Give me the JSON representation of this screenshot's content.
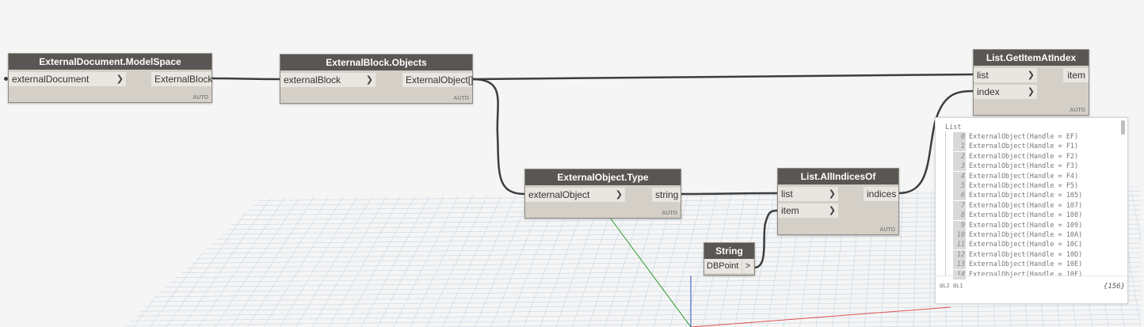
{
  "nodes": {
    "model_space": {
      "title": "ExternalDocument.ModelSpace",
      "input": "externalDocument",
      "output": "ExternalBlock",
      "lacing": "AUTO"
    },
    "block_objects": {
      "title": "ExternalBlock.Objects",
      "input": "externalBlock",
      "output": "ExternalObject[]",
      "lacing": "AUTO"
    },
    "object_type": {
      "title": "ExternalObject.Type",
      "input": "externalObject",
      "output": "string",
      "lacing": "AUTO"
    },
    "all_indices": {
      "title": "List.AllIndicesOf",
      "input_list": "list",
      "input_item": "item",
      "output": "indices",
      "lacing": "AUTO"
    },
    "get_item": {
      "title": "List.GetItemAtIndex",
      "input_list": "list",
      "input_index": "index",
      "output": "item",
      "lacing": "AUTO"
    },
    "string_node": {
      "title": "String",
      "value": "DBPoint",
      "output": ">"
    }
  },
  "preview": {
    "header": "List",
    "items": [
      {
        "index": "0",
        "text": "ExternalObject(Handle = EF)"
      },
      {
        "index": "1",
        "text": "ExternalObject(Handle = F1)"
      },
      {
        "index": "2",
        "text": "ExternalObject(Handle = F2)"
      },
      {
        "index": "3",
        "text": "ExternalObject(Handle = F3)"
      },
      {
        "index": "4",
        "text": "ExternalObject(Handle = F4)"
      },
      {
        "index": "5",
        "text": "ExternalObject(Handle = F5)"
      },
      {
        "index": "6",
        "text": "ExternalObject(Handle = 105)"
      },
      {
        "index": "7",
        "text": "ExternalObject(Handle = 107)"
      },
      {
        "index": "8",
        "text": "ExternalObject(Handle = 108)"
      },
      {
        "index": "9",
        "text": "ExternalObject(Handle = 109)"
      },
      {
        "index": "10",
        "text": "ExternalObject(Handle = 10A)"
      },
      {
        "index": "11",
        "text": "ExternalObject(Handle = 10C)"
      },
      {
        "index": "12",
        "text": "ExternalObject(Handle = 10D)"
      },
      {
        "index": "13",
        "text": "ExternalObject(Handle = 10E)"
      },
      {
        "index": "14",
        "text": "ExternalObject(Handle = 10F)"
      }
    ],
    "levels": "@L2 @L1",
    "count": "{156}"
  },
  "colors": {
    "node_header": "#5a5654",
    "node_body": "#d4d0c8",
    "wire": "#3d3d3d",
    "grid": "#c7d6e4",
    "x_axis": "#e05050",
    "y_axis": "#2a9a2a",
    "z_axis": "#3050d0"
  }
}
